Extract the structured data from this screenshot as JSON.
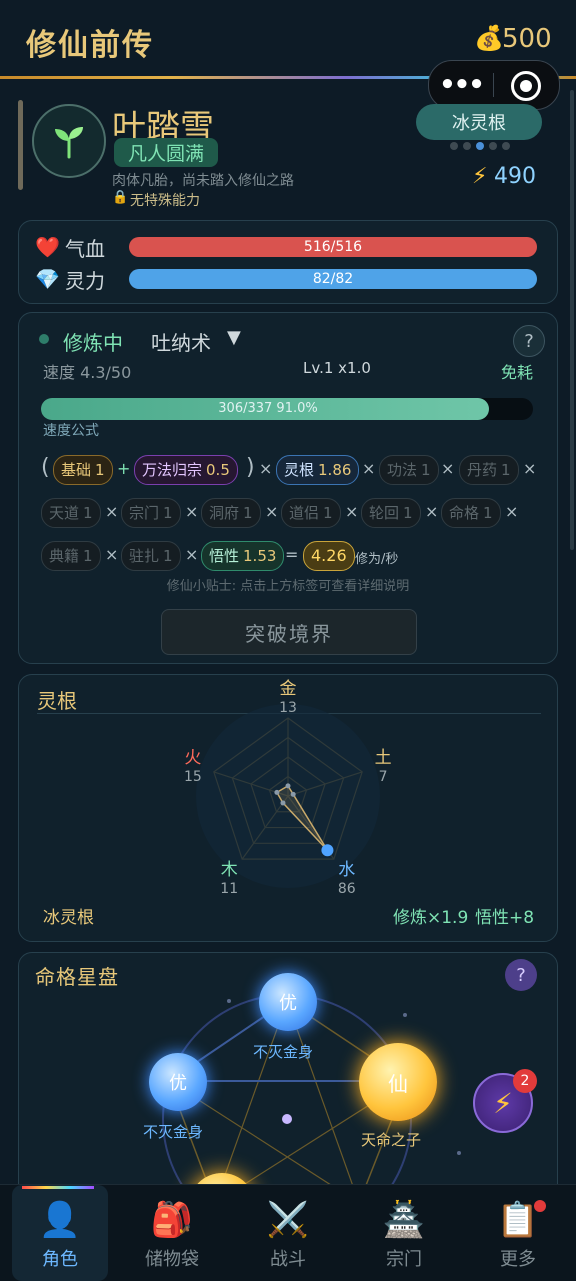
{
  "header": {
    "title": "修仙前传",
    "gold_icon": "money-bag-icon",
    "gold": "500"
  },
  "capsule": {
    "more": "•••",
    "close_icon": "target-icon"
  },
  "character": {
    "name": "叶踏雪",
    "realm": "凡人圆满",
    "desc": "肉体凡胎，尚未踏入修仙之路",
    "ability": "无特殊能力",
    "root_badge": "冰灵根",
    "power": "490"
  },
  "stats": {
    "hp": {
      "label": "气血",
      "value": "516/516",
      "fraction": 1.0,
      "color": "#d9534f"
    },
    "mp": {
      "label": "灵力",
      "value": "82/82",
      "fraction": 1.0,
      "color": "#4fa3e8"
    }
  },
  "cultivation": {
    "status": "修炼中",
    "method": "吐纳术",
    "help": "?",
    "speed": "速度 4.3/50",
    "level": "Lv.1 x1.0",
    "cost": "免耗",
    "progress_text": "306/337  91.0%",
    "progress_fraction": 0.91,
    "formula_label": "速度公式",
    "factors": {
      "base": {
        "label": "基础",
        "value": "1"
      },
      "wanfa": {
        "label": "万法归宗",
        "value": "0.5"
      },
      "root": {
        "label": "灵根",
        "value": "1.86"
      },
      "gongfa": {
        "label": "功法",
        "value": "1"
      },
      "danyao": {
        "label": "丹药",
        "value": "1"
      },
      "tiandao": {
        "label": "天道",
        "value": "1"
      },
      "zongmen": {
        "label": "宗门",
        "value": "1"
      },
      "dongfu": {
        "label": "洞府",
        "value": "1"
      },
      "daolv": {
        "label": "道侣",
        "value": "1"
      },
      "lunhui": {
        "label": "轮回",
        "value": "1"
      },
      "mingge": {
        "label": "命格",
        "value": "1"
      },
      "dianji": {
        "label": "典籍",
        "value": "1"
      },
      "zhuzha": {
        "label": "驻扎",
        "value": "1"
      },
      "wuxing": {
        "label": "悟性",
        "value": "1.53"
      }
    },
    "result": "4.26",
    "unit": "修为/秒",
    "tip": "修仙小贴士: 点击上方标签可查看详细说明",
    "breakthrough": "突破境界"
  },
  "spirit_root": {
    "title": "灵根",
    "elements": [
      {
        "name": "金",
        "value": 13,
        "color": "#e8c87a"
      },
      {
        "name": "土",
        "value": 7,
        "color": "#e8c87a"
      },
      {
        "name": "水",
        "value": 86,
        "color": "#6db8ff"
      },
      {
        "name": "木",
        "value": 11,
        "color": "#7fe3b4"
      },
      {
        "name": "火",
        "value": 15,
        "color": "#ff6b5b"
      }
    ],
    "root_name": "冰灵根",
    "bonus_cultivate": "修炼×1.9",
    "bonus_wuxing": "悟性+8"
  },
  "star_disk": {
    "title": "命格星盘",
    "help": "?",
    "orbs": [
      {
        "glyph": "优",
        "label": "不灭金身"
      },
      {
        "glyph": "优",
        "label": "不灭金身"
      },
      {
        "glyph": "仙",
        "label": "天命之子"
      }
    ],
    "bolt_icon": "lightning-icon",
    "bolt_badge": "2"
  },
  "tabs": [
    {
      "label": "角色",
      "icon": "person-icon"
    },
    {
      "label": "储物袋",
      "icon": "backpack-icon"
    },
    {
      "label": "战斗",
      "icon": "crossed-swords-icon"
    },
    {
      "label": "宗门",
      "icon": "temple-icon"
    },
    {
      "label": "更多",
      "icon": "clipboard-icon"
    }
  ]
}
